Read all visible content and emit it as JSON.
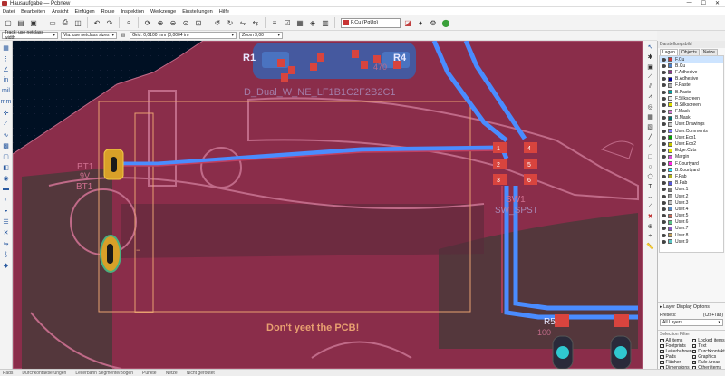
{
  "window": {
    "title": "Hausaufgabe — Pcbnew",
    "controls": [
      "—",
      "☐",
      "✕"
    ]
  },
  "menu": [
    "Datei",
    "Bearbeiten",
    "Ansicht",
    "Einfügen",
    "Route",
    "Inspektion",
    "Werkzeuge",
    "Einstellungen",
    "Hilfe"
  ],
  "toolbar": {
    "layer_select": "F.Cu (PgUp)",
    "icons": [
      "new-icon",
      "open-icon",
      "save-icon",
      "page-settings-icon",
      "print-icon",
      "plot-icon",
      "undo-icon",
      "redo-icon",
      "find-icon",
      "refresh-icon",
      "zoom-in-icon",
      "zoom-out-icon",
      "zoom-fit-icon",
      "zoom-selection-icon",
      "rotate-ccw-icon",
      "rotate-cw-icon",
      "flip-icon",
      "netlist-icon",
      "drc-icon",
      "footprint-editor-icon",
      "3d-viewer-icon",
      "layer-pair-icon",
      "python-icon",
      "scripting-icon",
      "highlight-net-icon"
    ]
  },
  "options": {
    "track": "Track: use netclass width",
    "via": "Via: use netclass sizes",
    "grid": "Grid: 0,0100 mm (0,0004 in)",
    "zoom": "Zoom 3,00"
  },
  "board_labels": {
    "r1": "R1",
    "r4": "R4",
    "r4_val": "470",
    "d1": "D_Dual_W_NE_LF1B1C2F2B2C1",
    "bt1": "BT1",
    "bt1_ref": "BT1",
    "bt1_val": "9V",
    "sw1": "SW1",
    "sw1_val": "SW_SPST",
    "r5": "R5",
    "r5_val": "100",
    "silk_text": "Don't yeet the PCB!",
    "pad_1": "1",
    "pad_2": "2",
    "pad_3": "3",
    "pad_4": "4",
    "pad_5": "5",
    "pad_6": "6",
    "dash": "−"
  },
  "side_panel": {
    "title": "Darstellungsbild",
    "tabs": [
      "Lagen",
      "Objects",
      "Netze"
    ],
    "layers": [
      {
        "name": "F.Cu",
        "color": "#c83434"
      },
      {
        "name": "B.Cu",
        "color": "#4d7fc4"
      },
      {
        "name": "F.Adhesive",
        "color": "#8a3a8a"
      },
      {
        "name": "B.Adhesive",
        "color": "#0000a0"
      },
      {
        "name": "F.Paste",
        "color": "#b0b0b0"
      },
      {
        "name": "B.Paste",
        "color": "#00a0a0"
      },
      {
        "name": "F.Silkscreen",
        "color": "#e8e8e8"
      },
      {
        "name": "B.Silkscreen",
        "color": "#e0e000"
      },
      {
        "name": "F.Mask",
        "color": "#d47ad4"
      },
      {
        "name": "B.Mask",
        "color": "#0a6a6a"
      },
      {
        "name": "User.Drawings",
        "color": "#c8c8c8"
      },
      {
        "name": "User.Comments",
        "color": "#7a7aff"
      },
      {
        "name": "User.Eco1",
        "color": "#00a000"
      },
      {
        "name": "User.Eco2",
        "color": "#c8c800"
      },
      {
        "name": "Edge.Cuts",
        "color": "#e8e800"
      },
      {
        "name": "Margin",
        "color": "#d450d4"
      },
      {
        "name": "F.Courtyard",
        "color": "#ff26e2"
      },
      {
        "name": "B.Courtyard",
        "color": "#26e9ff"
      },
      {
        "name": "F.Fab",
        "color": "#afaf18"
      },
      {
        "name": "B.Fab",
        "color": "#5858d8"
      },
      {
        "name": "User.1",
        "color": "#808080"
      },
      {
        "name": "User.2",
        "color": "#a0a0a0"
      },
      {
        "name": "User.3",
        "color": "#c0c0c0"
      },
      {
        "name": "User.4",
        "color": "#5a8ac4"
      },
      {
        "name": "User.5",
        "color": "#c46a5a"
      },
      {
        "name": "User.6",
        "color": "#5ac48a"
      },
      {
        "name": "User.7",
        "color": "#8a5ac4"
      },
      {
        "name": "User.8",
        "color": "#c4a05a"
      },
      {
        "name": "User.9",
        "color": "#5ac4c4"
      }
    ],
    "layer_display_options": "Layer Display Options",
    "presets_label": "Presets:",
    "presets_shortcut": "(Ctrl+Tab)",
    "presets_value": "All Layers",
    "selection_filter_title": "Selection Filter",
    "filters": [
      "All items",
      "Locked items",
      "Footprints",
      "Text",
      "Leiterbahnen",
      "Durchkontaktierungen",
      "Pads",
      "Graphics",
      "Flächen",
      "Rule Areas",
      "Dimensions",
      "Other items"
    ]
  },
  "status": [
    "Pads",
    "Durchkontaktierungen",
    "Leiterbahn Segmente/Bögen",
    "Punkte",
    "Netze",
    "Nicht geroutet"
  ]
}
